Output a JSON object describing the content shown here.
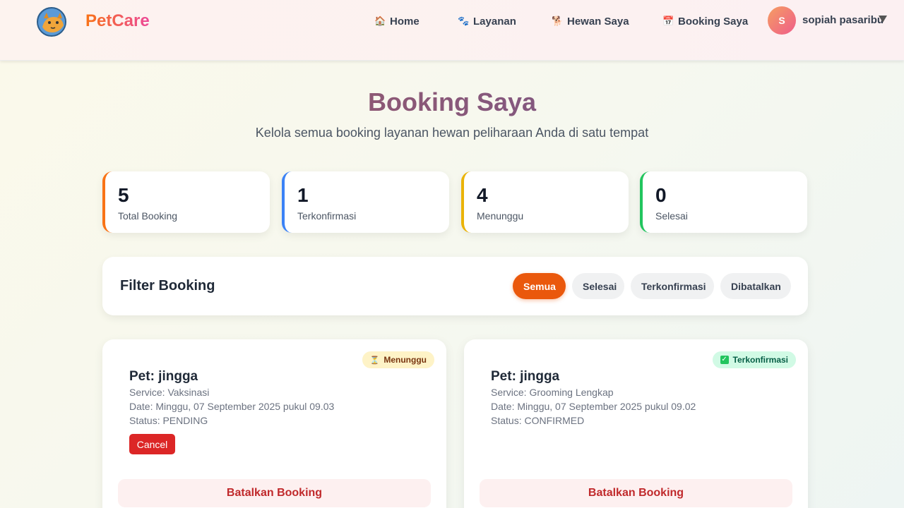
{
  "navbar": {
    "brand": "PetCare",
    "items": [
      {
        "label": "Home",
        "icon": "house-icon",
        "glyph": "🏠"
      },
      {
        "label": "Layanan",
        "icon": "paw-icon",
        "glyph": "🐾"
      },
      {
        "label": "Hewan Saya",
        "icon": "pet-icon",
        "glyph": "🐕"
      },
      {
        "label": "Booking Saya",
        "icon": "calendar-icon",
        "glyph": "📅"
      }
    ],
    "user": {
      "initial": "S",
      "name": "sopiah pasaribu"
    }
  },
  "header": {
    "title": "Booking Saya",
    "subtitle": "Kelola semua booking layanan hewan peliharaan Anda di satu tempat"
  },
  "stats": [
    {
      "value": "5",
      "label": "Total Booking",
      "color": "#f97316"
    },
    {
      "value": "1",
      "label": "Terkonfirmasi",
      "color": "#3b82f6"
    },
    {
      "value": "4",
      "label": "Menunggu",
      "color": "#eab308"
    },
    {
      "value": "0",
      "label": "Selesai",
      "color": "#22c55e"
    }
  ],
  "filter": {
    "title": "Filter Booking",
    "options": [
      "Semua",
      "Selesai",
      "Terkonfirmasi",
      "Dibatalkan"
    ],
    "active": "Semua"
  },
  "bookings": [
    {
      "badge": "Menunggu",
      "pet": "Pet: jingga",
      "service": "Service: Vaksinasi",
      "date": "Date: Minggu, 07 September 2025 pukul 09.03",
      "status": "Status: PENDING",
      "cancel_label": "Cancel",
      "batal_label": "Batalkan Booking"
    },
    {
      "badge": "Terkonfirmasi",
      "pet": "Pet: jingga",
      "service": "Service: Grooming Lengkap",
      "date": "Date: Minggu, 07 September 2025 pukul 09.02",
      "status": "Status: CONFIRMED",
      "batal_label": "Batalkan Booking"
    }
  ]
}
